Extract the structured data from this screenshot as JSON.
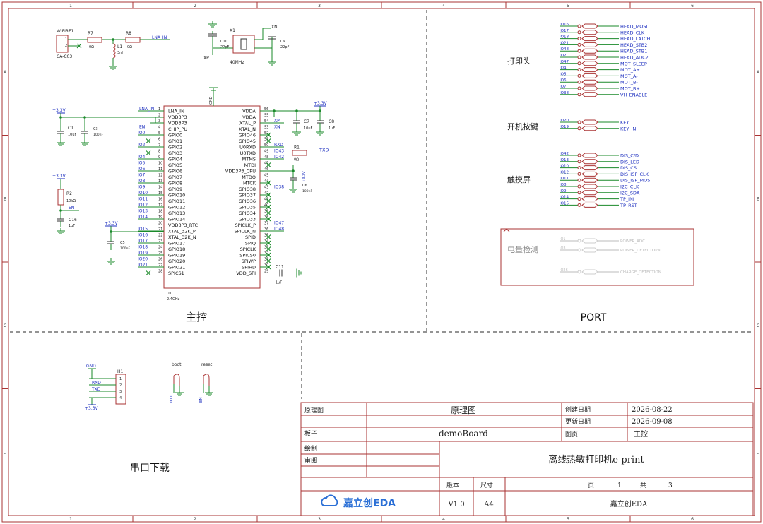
{
  "frame": {
    "cols": [
      "1",
      "2",
      "3",
      "4",
      "5",
      "6"
    ],
    "rows": [
      "A",
      "B",
      "C",
      "D"
    ]
  },
  "sections": {
    "main": "主控",
    "port": "PORT",
    "serial": "串口下载"
  },
  "antenna": {
    "conn_ref": "WIFIRF1",
    "conn_part": "CA-C03",
    "r7_ref": "R7",
    "r7_val": "0Ω",
    "r8_ref": "R8",
    "r8_val": "0Ω",
    "l1_ref": "L1",
    "l1_val": "3nH",
    "net": "LNA_IN",
    "pin1": "1",
    "pin2": "2"
  },
  "crystal": {
    "ref": "X1",
    "freq": "40MHz",
    "c_left": "C10",
    "c_left_val": "22pF",
    "c_right": "C9",
    "c_right_val": "22pF",
    "xp": "XP",
    "xn": "XN"
  },
  "power_left": {
    "v1": "+3.3V",
    "c1_ref": "C1",
    "c1_val": "10uF",
    "c3_ref": "C3",
    "c3_val": "100nF",
    "v2": "+3.3V",
    "r2_ref": "R2",
    "r2_val": "10kΩ",
    "c16_ref": "C16",
    "c16_val": "1uF",
    "en": "EN",
    "v3": "+3.3V",
    "c5_ref": "C5",
    "c5_val": "100nF"
  },
  "mcu": {
    "ref": "U1",
    "part": "2.4GHz",
    "gnd_pin": "GND",
    "left_nets": [
      "LNA_IN",
      "",
      "",
      "EN",
      "IO0",
      "",
      "IO2",
      "",
      "IO4",
      "IO5",
      "IO6",
      "IO7",
      "IO8",
      "IO9",
      "IO10",
      "IO11",
      "IO12",
      "IO13",
      "IO14",
      "",
      "IO15",
      "IO16",
      "IO17",
      "IO18",
      "IO19",
      "IO20",
      "IO21",
      ""
    ],
    "left_pins": [
      "LNA_IN",
      "VDD3P3",
      "VDD3P3",
      "CHIP_PU",
      "GPIO0",
      "GPIO1",
      "GPIO2",
      "GPIO3",
      "GPIO4",
      "GPIO5",
      "GPIO6",
      "GPIO7",
      "GPIO8",
      "GPIO9",
      "GPIO10",
      "GPIO11",
      "GPIO12",
      "GPIO13",
      "GPIO14",
      "VDD3P3_RTC",
      "XTAL_32K_P",
      "XTAL_32K_N",
      "GPIO17",
      "GPIO18",
      "GPIO19",
      "GPIO20",
      "GPIO21",
      "SPICS1"
    ],
    "left_nums": [
      "1",
      "2",
      "3",
      "4",
      "5",
      "6",
      "7",
      "8",
      "9",
      "10",
      "11",
      "12",
      "13",
      "14",
      "15",
      "16",
      "17",
      "18",
      "19",
      "20",
      "21",
      "22",
      "23",
      "24",
      "25",
      "26",
      "27",
      "28"
    ],
    "right_pins": [
      "VDDA",
      "VDDA",
      "XTAL_P",
      "XTAL_N",
      "GPIO46",
      "GPIO45",
      "U0RXD",
      "U0TXD",
      "MTMS",
      "MTDI",
      "VDD3P3_CPU",
      "MTDO",
      "MTCK",
      "GPIO38",
      "GPIO37",
      "GPIO36",
      "GPIO35",
      "GPIO34",
      "GPIO33",
      "SPICLK_P",
      "SPICLK_N",
      "SPID",
      "SPIQ",
      "SPICLK",
      "SPICS0",
      "SPIWP",
      "SPIHD",
      "VDD_SPI"
    ],
    "right_nums": [
      "56",
      "55",
      "54",
      "53",
      "52",
      "51",
      "50",
      "49",
      "48",
      "47",
      "46",
      "45",
      "44",
      "43",
      "42",
      "41",
      "40",
      "39",
      "38",
      "37",
      "36",
      "35",
      "34",
      "33",
      "32",
      "31",
      "30",
      "29"
    ],
    "right_nets": [
      "",
      "",
      "XP",
      "XN",
      "",
      "",
      "RXD",
      "IO43",
      "IO42",
      "",
      "",
      "",
      "",
      "IO38",
      "",
      "",
      "",
      "",
      "",
      "IO47",
      "IO48",
      "",
      "",
      "",
      "",
      "",
      "",
      ""
    ]
  },
  "right_passives": {
    "v": "+3.3V",
    "c7_ref": "C7",
    "c7_val": "10uF",
    "c8_ref": "C8",
    "c8_val": "1uF",
    "r1_ref": "R1",
    "r1_val": "0Ω",
    "txd": "TXD",
    "cpu_v": "+3.3V",
    "c6_ref": "C6",
    "c6_val": "100nF",
    "c11_ref": "C11",
    "c11_val": "1uF"
  },
  "port": {
    "printhead": {
      "title": "打印头",
      "ios": [
        "IO16",
        "IO17",
        "IO18",
        "IO21",
        "IO48",
        "IO2",
        "IO47",
        "IO4",
        "IO5",
        "IO6",
        "IO7",
        "IO38"
      ],
      "nets": [
        "HEAD_MOSI",
        "HEAD_CLK",
        "HEAD_LATCH",
        "HEAD_STB2",
        "HEAD_STB1",
        "HEAD_ADC2",
        "MOT_SLEEP",
        "MOT_A+",
        "MOT_A-",
        "MOT_B-",
        "MOT_B+",
        "VH_ENABLE"
      ]
    },
    "button": {
      "title": "开机按键",
      "ios": [
        "IO20",
        "IO19"
      ],
      "nets": [
        "KEY",
        "KEY_IN"
      ]
    },
    "touch": {
      "title": "触摸屏",
      "ios": [
        "IO42",
        "IO13",
        "IO10",
        "IO12",
        "IO11",
        "IO8",
        "IO9",
        "IO14",
        "IO15"
      ],
      "nets": [
        "DIS_C/D",
        "DIS_LED",
        "DIS_CS",
        "DIS_ISP_CLK",
        "DIS_ISP_MOSI",
        "I2C_CLK",
        "I2C_SDA",
        "TP_INI",
        "TP_RST"
      ]
    },
    "battery": {
      "title": "电量检测",
      "ios": [
        "IO1",
        "IO3",
        "IO26"
      ],
      "nets": [
        "POWER_ADC",
        "POWER_DETECTOPN",
        "CHARGE_DETECTION"
      ]
    }
  },
  "serial": {
    "ref": "H1",
    "nets": [
      "GND",
      "RXD",
      "TXD",
      "+3.3V"
    ],
    "pins": [
      "1",
      "2",
      "3",
      "4"
    ],
    "boot": "boot",
    "reset": "reset",
    "boot_net": "IO0",
    "reset_net": "EN"
  },
  "title_block": {
    "label_schematic": "原理图",
    "value_schematic": "原理图",
    "label_board": "板子",
    "value_board": "demoBoard",
    "label_draw": "绘制",
    "label_review": "审阅",
    "label_created": "创建日期",
    "value_created": "2026-08-22",
    "label_updated": "更新日期",
    "value_updated": "2026-09-08",
    "label_page": "图页",
    "value_page": "主控",
    "project": "离线热敏打印机e-print",
    "label_version": "版本",
    "label_size": "尺寸",
    "label_pageno": "页",
    "pageno": "1",
    "label_total": "共",
    "total": "3",
    "logo": "嘉立创EDA",
    "version": "V1.0",
    "size": "A4",
    "company": "嘉立创EDA"
  },
  "colors": {
    "border": "#a33",
    "wire": "#1a8a2a",
    "net": "#1d2fbf",
    "body": "#a33",
    "dash": "#555"
  }
}
